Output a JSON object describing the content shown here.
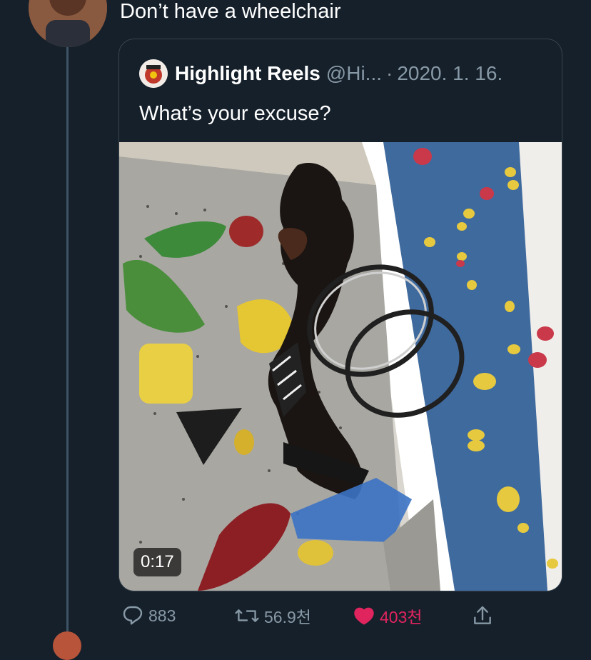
{
  "tweet": {
    "text": "Don’t have a wheelchair"
  },
  "quoted_tweet": {
    "name": "Highlight Reels",
    "handle": "@Hi...",
    "separator": "·",
    "date": "2020. 1. 16.",
    "text": "What’s your excuse?",
    "media": {
      "type": "video",
      "duration": "0:17"
    }
  },
  "actions": {
    "reply_count": "883",
    "retweet_count": "56.9천",
    "like_count": "403천",
    "liked": true,
    "icons": [
      "reply-icon",
      "retweet-icon",
      "heart-icon",
      "share-icon"
    ]
  },
  "colors": {
    "background": "#15202b",
    "secondary_text": "#8899a6",
    "border": "#38444d",
    "like": "#e0245e",
    "thread_line": "#3d5466"
  }
}
